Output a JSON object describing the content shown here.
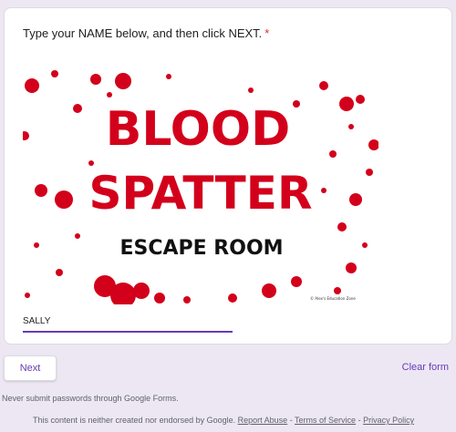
{
  "question": {
    "text": "Type your NAME below, and then click NEXT.",
    "required_mark": "*"
  },
  "banner": {
    "line1": "BLOOD",
    "line2": "SPATTER",
    "line3": "ESCAPE ROOM",
    "credit": "© Alex's Education Zone",
    "title_color": "#d3001b"
  },
  "answer": {
    "value": "SALLY",
    "underline_color": "#673ab7"
  },
  "buttons": {
    "next": "Next",
    "clear": "Clear form"
  },
  "footer": {
    "warning": "Never submit passwords through Google Forms.",
    "disclaimer": "This content is neither created nor endorsed by Google.",
    "report_abuse": "Report Abuse",
    "sep1": " - ",
    "terms": "Terms of Service",
    "sep2": " - ",
    "privacy": "Privacy Policy"
  },
  "colors": {
    "background": "#ede7f4",
    "accent": "#673ab7"
  }
}
